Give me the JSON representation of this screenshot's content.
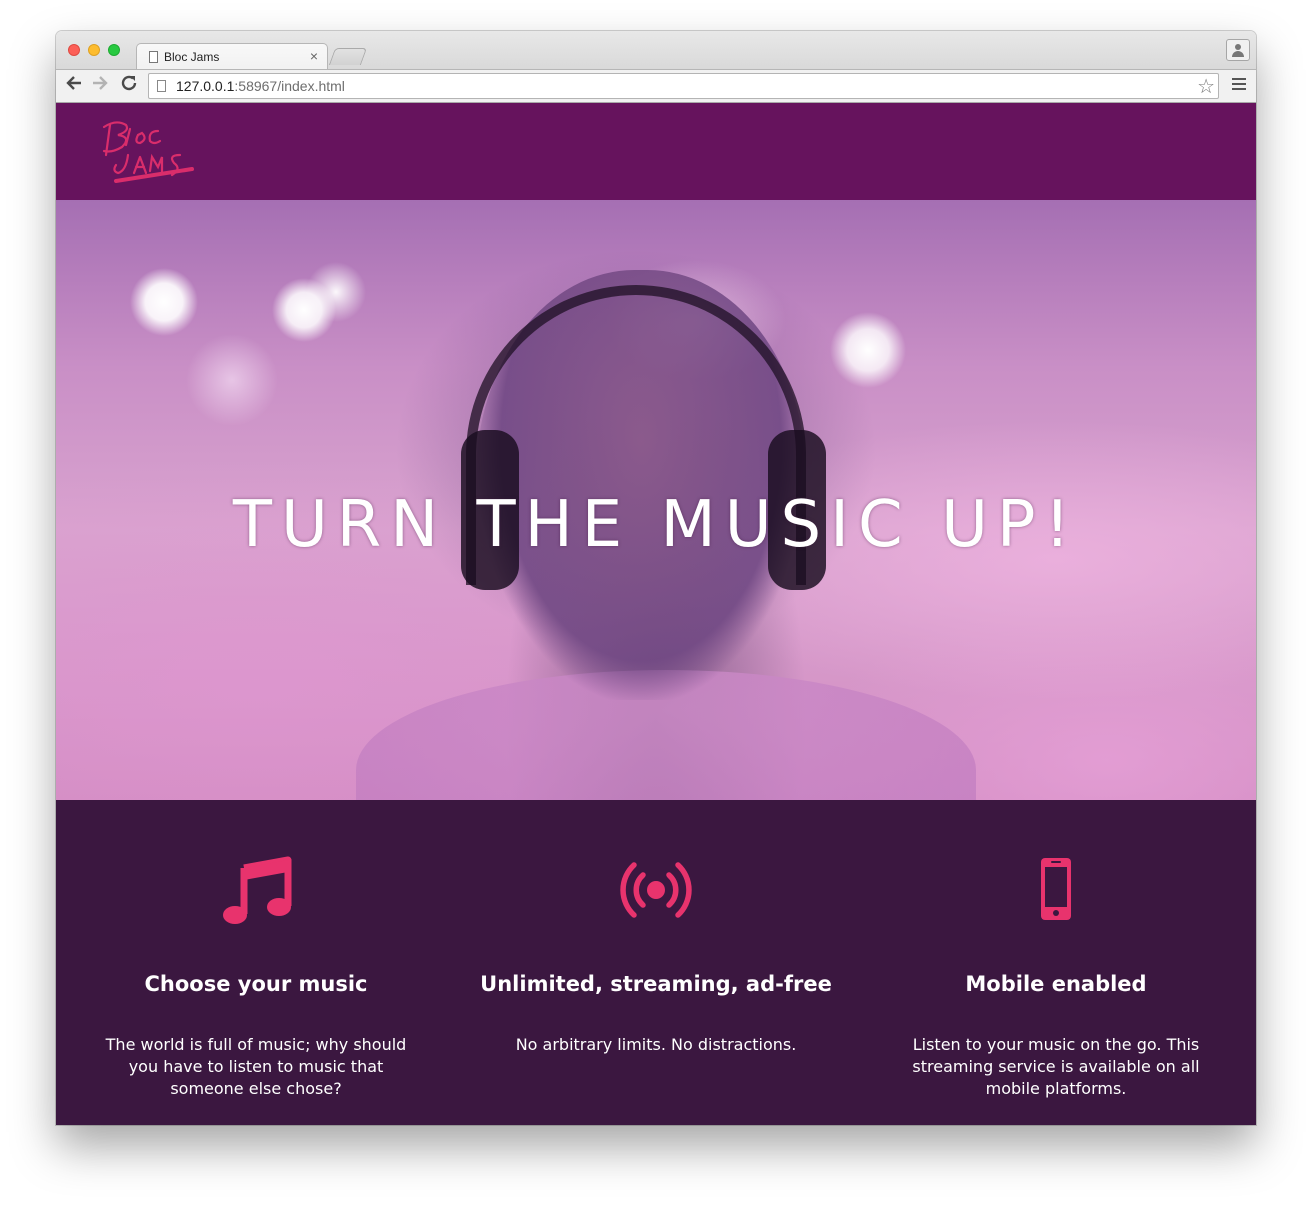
{
  "browser": {
    "tab_title": "Bloc Jams",
    "tab_close": "×",
    "url_host": "127.0.0.1",
    "url_rest": ":58967/index.html"
  },
  "site": {
    "brand_color": "#66135d",
    "accent_color": "#e8336d",
    "features_bg": "#3b1740"
  },
  "hero": {
    "title": "TURN THE MUSIC UP!"
  },
  "features": [
    {
      "icon": "music-note-icon",
      "title": "Choose your music",
      "text": "The world is full of music; why should you have to listen to music that someone else chose?"
    },
    {
      "icon": "broadcast-icon",
      "title": "Unlimited, streaming, ad-free",
      "text": "No arbitrary limits. No distractions."
    },
    {
      "icon": "mobile-phone-icon",
      "title": "Mobile enabled",
      "text": "Listen to your music on the go. This streaming service is available on all mobile platforms."
    }
  ]
}
